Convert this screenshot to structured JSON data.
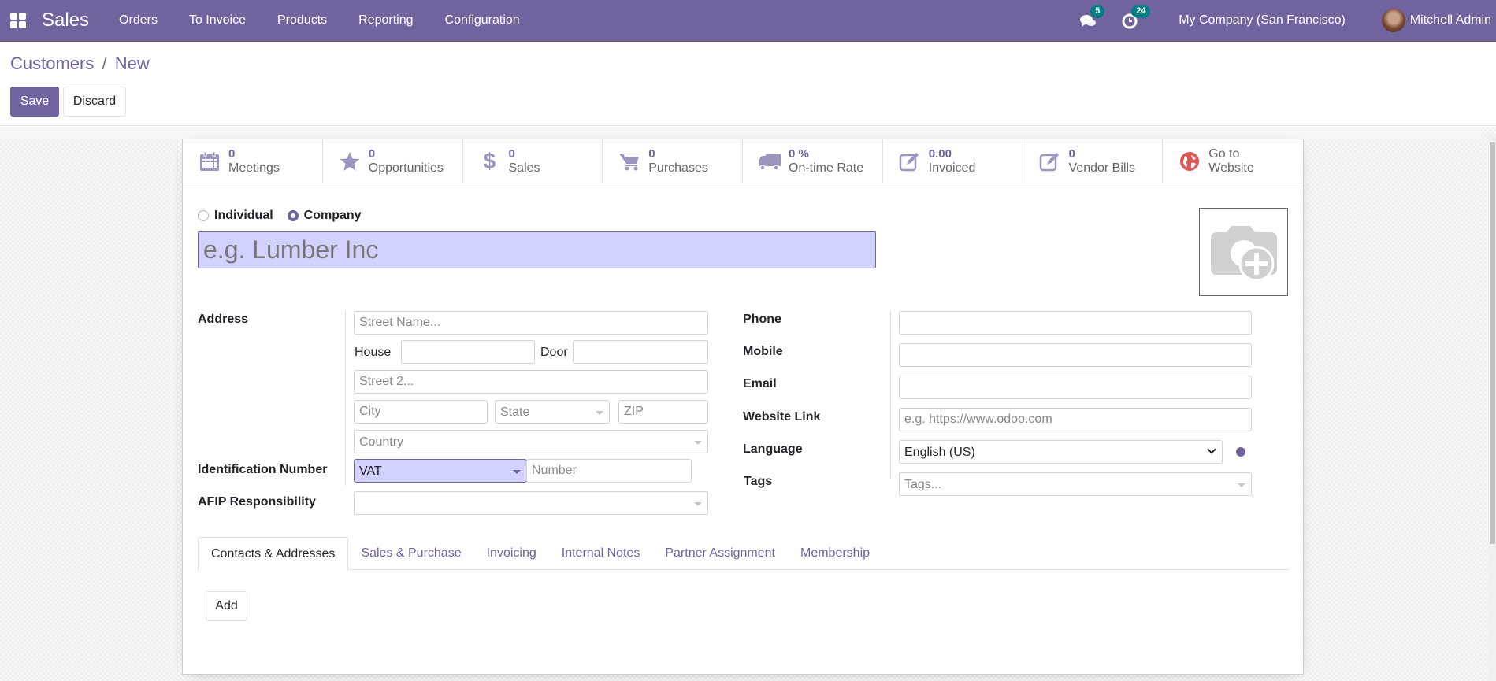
{
  "navbar": {
    "app_name": "Sales",
    "menu": [
      "Orders",
      "To Invoice",
      "Products",
      "Reporting",
      "Configuration"
    ],
    "messages_count": "5",
    "activities_count": "24",
    "company": "My Company (San Francisco)",
    "user_name": "Mitchell Admin",
    "colors": {
      "brand": "#71639e",
      "badge": "#017e84"
    }
  },
  "control_panel": {
    "breadcrumb_parent": "Customers",
    "breadcrumb_separator": "/",
    "breadcrumb_current": "New",
    "save_label": "Save",
    "discard_label": "Discard"
  },
  "button_box": [
    {
      "icon": "calendar-icon",
      "value": "0",
      "label": "Meetings"
    },
    {
      "icon": "star-icon",
      "value": "0",
      "label": "Opportunities"
    },
    {
      "icon": "dollar-icon",
      "value": "0",
      "label": "Sales"
    },
    {
      "icon": "cart-icon",
      "value": "0",
      "label": "Purchases"
    },
    {
      "icon": "truck-icon",
      "value": "0 %",
      "label": "On-time Rate"
    },
    {
      "icon": "edit-icon",
      "value": "0.00",
      "label": "Invoiced"
    },
    {
      "icon": "edit-icon",
      "value": "0",
      "label": "Vendor Bills"
    },
    {
      "icon": "globe-icon",
      "value": "Go to",
      "label": "Website"
    }
  ],
  "company_type": {
    "options": [
      "Individual",
      "Company"
    ],
    "selected": "Company"
  },
  "name_field": {
    "placeholder": "e.g. Lumber Inc",
    "value": ""
  },
  "address": {
    "label": "Address",
    "street_placeholder": "Street Name...",
    "house_label": "House",
    "door_label": "Door",
    "street2_placeholder": "Street 2...",
    "city_placeholder": "City",
    "state_placeholder": "State",
    "zip_placeholder": "ZIP",
    "country_placeholder": "Country"
  },
  "identification": {
    "label": "Identification Number",
    "type_value": "VAT",
    "number_placeholder": "Number"
  },
  "afip": {
    "label": "AFIP Responsibility",
    "value": ""
  },
  "contact": {
    "phone_label": "Phone",
    "mobile_label": "Mobile",
    "email_label": "Email",
    "website_label": "Website Link",
    "website_placeholder": "e.g. https://www.odoo.com",
    "language_label": "Language",
    "language_value": "English (US)",
    "tags_label": "Tags",
    "tags_placeholder": "Tags..."
  },
  "notebook": {
    "tabs": [
      "Contacts & Addresses",
      "Sales & Purchase",
      "Invoicing",
      "Internal Notes",
      "Partner Assignment",
      "Membership"
    ],
    "active_tab": "Contacts & Addresses",
    "add_label": "Add"
  }
}
